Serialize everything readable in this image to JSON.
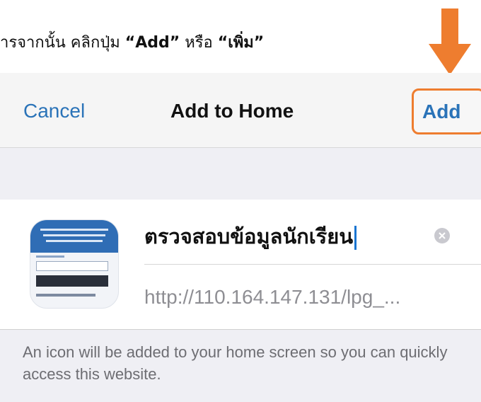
{
  "instruction": {
    "prefix": "ารจากนั้น คลิกปุ่ม ",
    "add_quoted": "“Add”",
    "middle": " หรือ ",
    "add_thai_quoted": "“เพิ่ม”"
  },
  "nav": {
    "cancel_label": "Cancel",
    "title": "Add to Home",
    "add_label": "Add"
  },
  "shortcut": {
    "name_value": "ตรวจสอบข้อมูลนักเรียน",
    "url": "http://110.164.147.131/lpg_..."
  },
  "footer_text": "An icon will be added to your home screen so you can quickly access this website.",
  "colors": {
    "accent_blue": "#2a73b8",
    "highlight_orange": "#ee7d2f",
    "arrow_orange": "#ee7d2f"
  },
  "icons": [
    "down-arrow-icon",
    "clear-icon",
    "website-thumbnail"
  ]
}
